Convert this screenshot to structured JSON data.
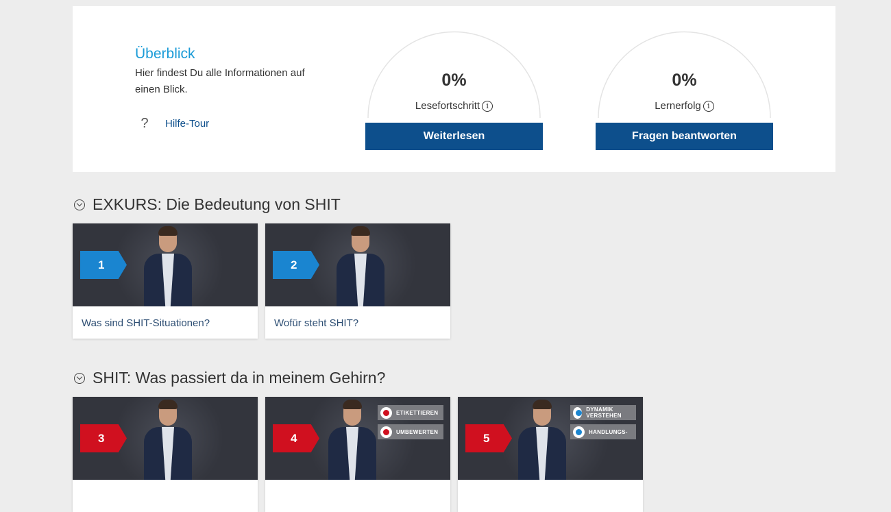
{
  "overview": {
    "title": "Überblick",
    "description": "Hier findest Du alle Informationen auf einen Blick.",
    "help_icon": "question-mark-icon",
    "help_label": "Hilfe-Tour"
  },
  "gauges": [
    {
      "percent_text": "0%",
      "progress": 0,
      "label": "Lesefortschritt",
      "button": "Weiterlesen"
    },
    {
      "percent_text": "0%",
      "progress": 0,
      "label": "Lernerfolg",
      "button": "Fragen beantworten"
    }
  ],
  "sections": [
    {
      "title": "EXKURS: Die Bedeutung von SHIT",
      "cards": [
        {
          "number": "1",
          "caption": "Was sind SHIT-Situationen?"
        },
        {
          "number": "2",
          "caption": "Wofür steht SHIT?"
        }
      ]
    },
    {
      "title": "SHIT: Was passiert da in meinem Gehirn?",
      "cards": [
        {
          "number": "3"
        },
        {
          "number": "4",
          "tags": [
            "ETIKETTIEREN",
            "UMBEWERTEN"
          ]
        },
        {
          "number": "5",
          "tags": [
            "DYNAMIK VERSTEHEN",
            "HANDLUNGS-"
          ]
        }
      ]
    }
  ],
  "colors": {
    "accent_blue": "#1a9bd7",
    "button_navy": "#0d4f8c",
    "badge_blue": "#1a85d0",
    "badge_red": "#d0101f",
    "background": "#ededed"
  }
}
